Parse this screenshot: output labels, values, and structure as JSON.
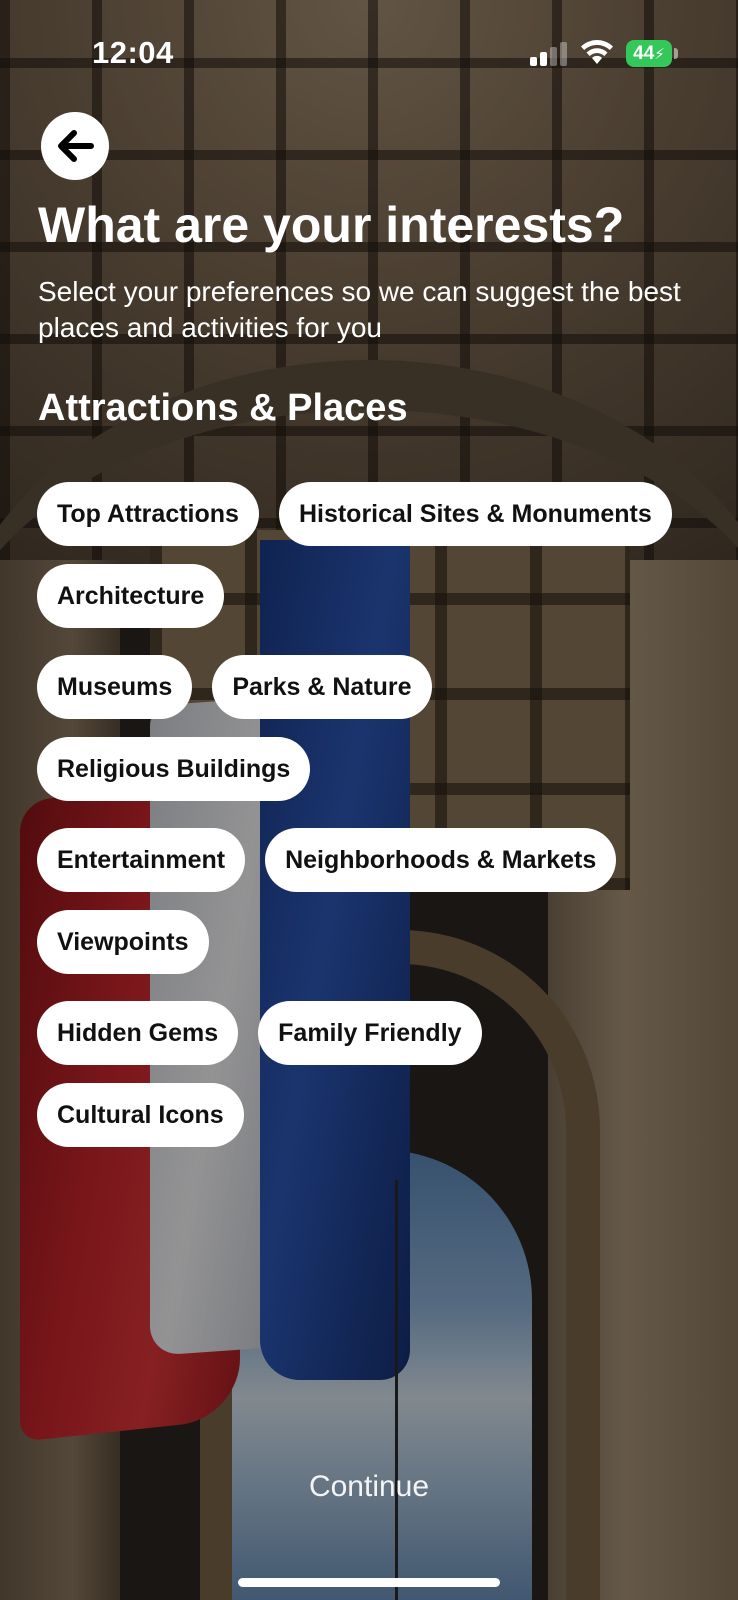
{
  "status_bar": {
    "time": "12:04",
    "battery": "44"
  },
  "header": {
    "title": "What are your interests?",
    "subtitle": "Select your preferences so we can suggest the best places and activities for you"
  },
  "section": {
    "title": "Attractions & Places"
  },
  "chips": {
    "top_attractions": "Top Attractions",
    "historical_sites": "Historical Sites & Monuments",
    "architecture": "Architecture",
    "museums": "Museums",
    "parks_nature": "Parks & Nature",
    "religious_buildings": "Religious Buildings",
    "entertainment": "Entertainment",
    "neighborhoods_markets": "Neighborhoods & Markets",
    "viewpoints": "Viewpoints",
    "hidden_gems": "Hidden Gems",
    "family_friendly": "Family Friendly",
    "cultural_icons": "Cultural Icons"
  },
  "footer": {
    "continue_label": "Continue"
  },
  "icons": {
    "back": "arrow-left-icon",
    "signal": "cellular-signal-icon",
    "wifi": "wifi-icon",
    "battery": "battery-charging-icon"
  },
  "colors": {
    "chip_background": "#ffffff",
    "chip_text": "#111111",
    "battery": "#34c759"
  }
}
